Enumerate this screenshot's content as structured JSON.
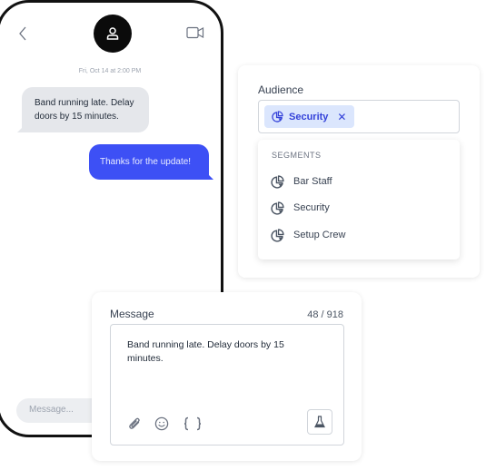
{
  "phone": {
    "header": {
      "back_icon": "chevron-left-icon",
      "avatar_icon": "user-icon",
      "video_icon": "video-camera-icon"
    },
    "timestamp": "Fri, Oct 14 at 2:00 PM",
    "messages": [
      {
        "direction": "incoming",
        "text": "Band running late. Delay doors by 15 minutes."
      },
      {
        "direction": "outgoing",
        "text": "Thanks for the update!"
      }
    ],
    "input": {
      "placeholder": "Message..."
    }
  },
  "audience": {
    "label": "Audience",
    "selected_chips": [
      {
        "label": "Security",
        "icon": "pie-chart-icon",
        "remove_icon": "close-icon"
      }
    ],
    "dropdown": {
      "heading": "SEGMENTS",
      "items": [
        {
          "label": "Bar Staff",
          "icon": "pie-chart-icon"
        },
        {
          "label": "Security",
          "icon": "pie-chart-icon"
        },
        {
          "label": "Setup Crew",
          "icon": "pie-chart-icon"
        }
      ]
    }
  },
  "message": {
    "label": "Message",
    "char_count": "48 / 918",
    "text": "Band running late. Delay doors by 15 minutes.",
    "toolbar": {
      "attach_icon": "paperclip-icon",
      "emoji_icon": "smiley-icon",
      "variables_icon": "curly-braces-icon",
      "test_icon": "flask-icon"
    }
  },
  "colors": {
    "accent": "#3d50f5",
    "chip_bg": "#dbe6fd",
    "chip_text": "#3442d9",
    "incoming_bubble": "#e5e7eb"
  }
}
